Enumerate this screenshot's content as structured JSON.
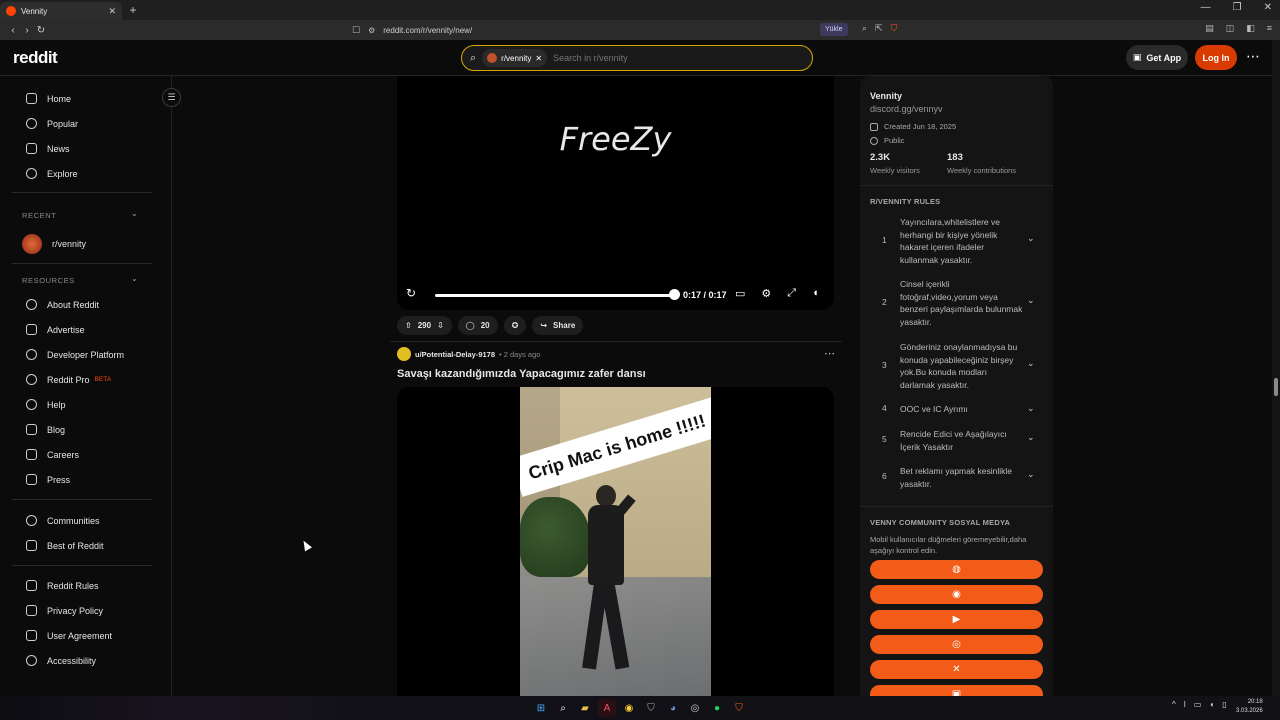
{
  "browser": {
    "tab_title": "Vennity",
    "url": "reddit.com/r/vennity/new/",
    "yukle_label": "Yükle"
  },
  "header": {
    "logo": "reddit",
    "search_chip": "r/vennity",
    "search_placeholder": "Search in r/vennity",
    "get_app": "Get App",
    "login": "Log In"
  },
  "leftnav": {
    "main": [
      "Home",
      "Popular",
      "News",
      "Explore"
    ],
    "recent_heading": "RECENT",
    "recent_item": "r/vennity",
    "resources_heading": "RESOURCES",
    "resources": [
      "About Reddit",
      "Advertise",
      "Developer Platform",
      "Reddit Pro",
      "Help",
      "Blog",
      "Careers",
      "Press"
    ],
    "beta": "BETA",
    "extra": [
      "Communities",
      "Best of Reddit"
    ],
    "legal": [
      "Reddit Rules",
      "Privacy Policy",
      "User Agreement",
      "Accessibility"
    ]
  },
  "post1": {
    "video_text": "FreeZy",
    "time": "0:17 / 0:17",
    "votes": "290",
    "comments": "20",
    "share": "Share",
    "progress": 1.0
  },
  "post2": {
    "user": "u/Potential-Delay-9178",
    "time": "• 2 days ago",
    "title": "Savaşı kazandığımızda Yapacagımız zafer dansı",
    "caption": "Crip Mac is home !!!!!"
  },
  "community": {
    "name": "Vennity",
    "link": "discord.gg/vennyv",
    "created": "Created Jun 18, 2025",
    "visibility": "Public",
    "weekly_visitors_value": "2.3K",
    "weekly_visitors_label": "Weekly visitors",
    "weekly_contrib_value": "183",
    "weekly_contrib_label": "Weekly contributions",
    "rules_heading": "R/VENNITY RULES",
    "rules": [
      {
        "n": "1",
        "t": "Yayıncılara,whitelistlere ve herhangi bir kişiye yönelik hakaret içeren ifadeler kullanmak yasaktır."
      },
      {
        "n": "2",
        "t": "Cinsel içerikli fotoğraf,video,yorum veya benzeri paylaşımlarda bulunmak yasaktır."
      },
      {
        "n": "3",
        "t": "Gönderiniz onaylanmadıysa bu konuda yapabileceğiniz birşey yok.Bu konuda modları darlamak yasaktır."
      },
      {
        "n": "4",
        "t": "OOC ve IC Ayrımı"
      },
      {
        "n": "5",
        "t": "Rencide Edici ve Aşağılayıcı İçerik Yasaktır"
      },
      {
        "n": "6",
        "t": "Bet reklamı yapmak kesinlikle yasaktır."
      }
    ],
    "social_heading": "VENNY COMMUNITY SOSYAL MEDYA",
    "social_desc": "Mobil kullanıcılar düğmeleri göremeyebilir,daha aşağıyı kontrol edin.",
    "social_buttons": [
      "globe-icon",
      "discord-icon",
      "youtube-icon",
      "instagram-icon",
      "x-icon",
      "twitch-icon"
    ]
  },
  "taskbar": {
    "time": "20:18",
    "date": "3.03.2026"
  },
  "colors": {
    "accent": "#ff4500",
    "login": "#d93a00",
    "social": "#f25b18",
    "search_border": "#d9a400"
  }
}
